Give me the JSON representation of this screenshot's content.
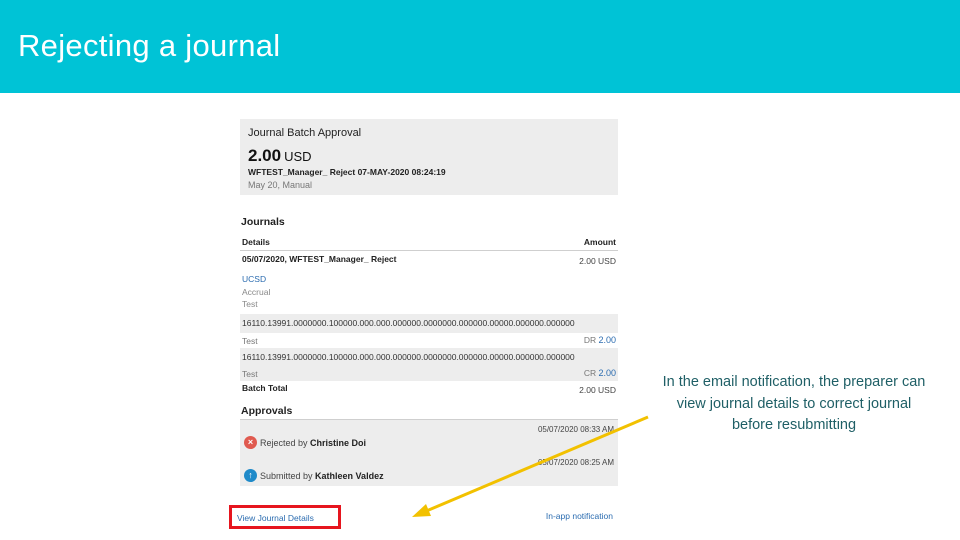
{
  "slide": {
    "title": "Rejecting a journal",
    "callout": "In the email notification, the preparer can view journal details to correct journal before resubmitting",
    "accent_color": "#00c3d6",
    "highlight_color": "#e6151e",
    "arrow_color": "#f2c100"
  },
  "notification": {
    "header": "Journal Batch Approval",
    "amount": "2.00",
    "currency": "USD",
    "batch_name": "WFTEST_Manager_ Reject 07-MAY-2020 08:24:19",
    "meta": "May 20, Manual",
    "journals": {
      "heading": "Journals",
      "col_details": "Details",
      "col_amount": "Amount",
      "journal_title": "05/07/2020, WFTEST_Manager_ Reject",
      "journal_amount": "2.00 USD",
      "ledger_link": "UCSD",
      "category": "Accrual",
      "description": "Test",
      "lines": [
        {
          "account": "16110.13991.0000000.100000.000.000.000000.0000000.000000.00000.000000.000000",
          "desc": "Test",
          "side": "DR",
          "value": "2.00"
        },
        {
          "account": "16110.13991.0000000.100000.000.000.000000.0000000.000000.00000.000000.000000",
          "desc": "Test",
          "side": "CR",
          "value": "2.00"
        }
      ],
      "batch_total_label": "Batch Total",
      "batch_total": "2.00 USD"
    },
    "approvals": {
      "heading": "Approvals",
      "items": [
        {
          "time": "05/07/2020 08:33 AM",
          "prefix": "Rejected by",
          "name": "Christine Doi",
          "icon": "rejected-x-icon",
          "icon_color": "#e05a4f"
        },
        {
          "time": "05/07/2020 08:25 AM",
          "prefix": "Submitted by",
          "name": "Kathleen Valdez",
          "icon": "submitted-arrow-icon",
          "icon_color": "#1f8ac9"
        }
      ]
    },
    "footer": {
      "view_link": "View Journal Details",
      "inapp_link": "In-app notification"
    }
  }
}
